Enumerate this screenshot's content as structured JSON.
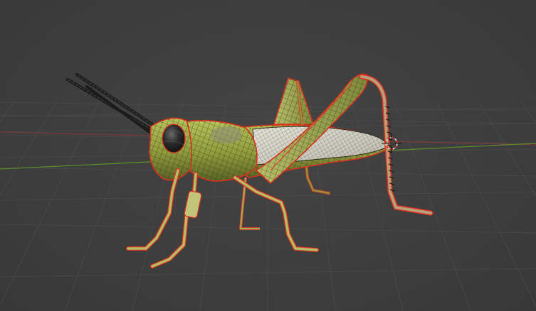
{
  "viewport": {
    "background": "#3d3d3d",
    "grid_line_color": "#4a4a4a",
    "x_axis_color": "#7a3a3a",
    "y_axis_color": "#4f7a2a"
  },
  "model": {
    "name": "grasshopper",
    "body_color": "#9aa845",
    "body_dark": "#5f6a2a",
    "wing_color": "#d8d8cc",
    "eye_color": "#1e1e1e",
    "wire_color": "#2a2a18",
    "seam_color": "#e0301e"
  },
  "cursor_3d": {
    "icon": "3d-cursor-icon"
  }
}
